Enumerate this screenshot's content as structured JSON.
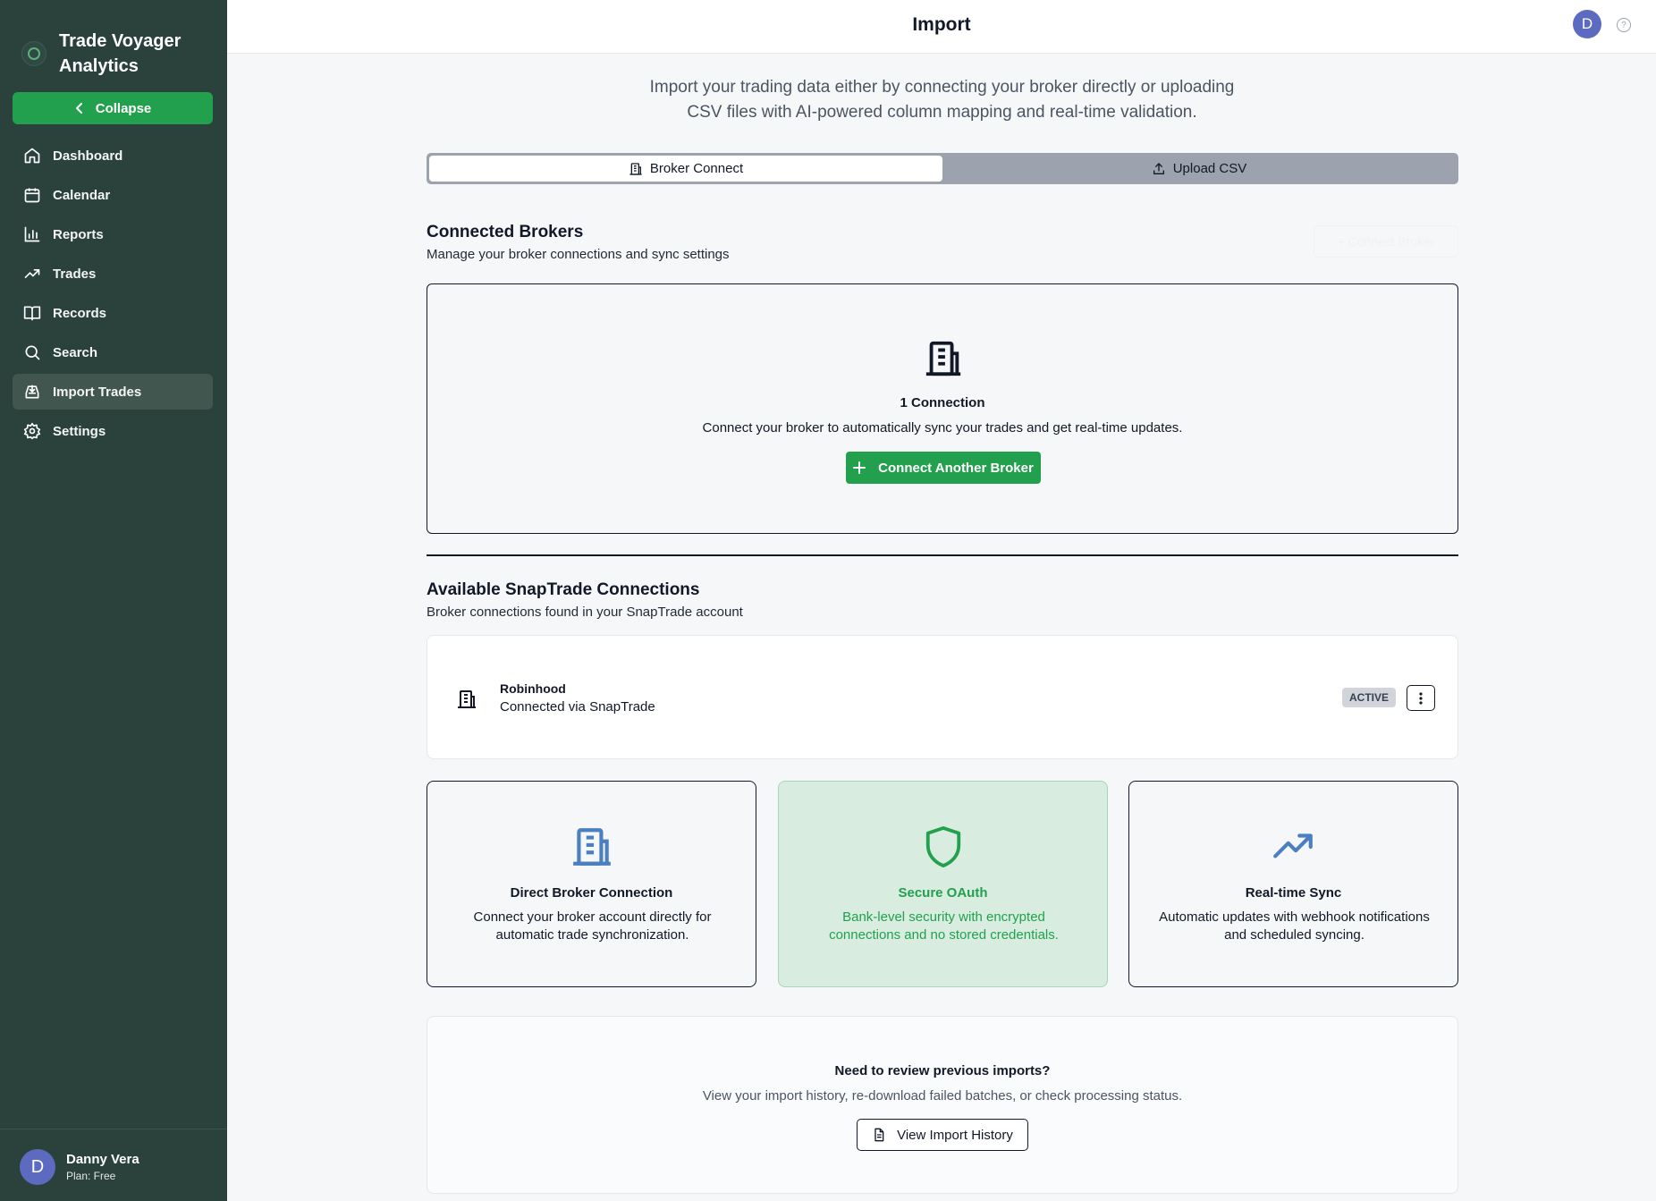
{
  "brand": {
    "name": "Trade Voyager Analytics"
  },
  "sidebar": {
    "collapse_label": "Collapse",
    "items": [
      {
        "label": "Dashboard",
        "icon": "home-icon"
      },
      {
        "label": "Calendar",
        "icon": "calendar-icon"
      },
      {
        "label": "Reports",
        "icon": "bar-chart-icon"
      },
      {
        "label": "Trades",
        "icon": "trending-up-icon"
      },
      {
        "label": "Records",
        "icon": "book-icon"
      },
      {
        "label": "Search",
        "icon": "search-icon"
      },
      {
        "label": "Import Trades",
        "icon": "import-icon",
        "active": true
      },
      {
        "label": "Settings",
        "icon": "gear-icon"
      }
    ],
    "user": {
      "initial": "D",
      "name": "Danny Vera",
      "plan": "Plan: Free"
    }
  },
  "header": {
    "title": "Import",
    "avatar_initial": "D",
    "help": "?"
  },
  "intro": {
    "line1": "Import your trading data either by connecting your broker directly or uploading",
    "line2": "CSV files with AI-powered column mapping and real-time validation."
  },
  "tabs": [
    {
      "label": "Broker Connect",
      "active": true
    },
    {
      "label": "Upload CSV",
      "active": false
    }
  ],
  "connected": {
    "title": "Connected Brokers",
    "subtitle": "Manage your broker connections and sync settings",
    "ghost_button": "+ Connect Broker",
    "count": "1 Connection",
    "description": "Connect your broker to automatically sync your trades and get real-time updates.",
    "button": "Connect Another Broker"
  },
  "available": {
    "title": "Available SnapTrade Connections",
    "subtitle": "Broker connections found in your SnapTrade account",
    "broker": {
      "name": "Robinhood",
      "via": "Connected via SnapTrade",
      "status": "ACTIVE"
    }
  },
  "features": [
    {
      "title": "Direct Broker Connection",
      "desc": "Connect your broker account directly for automatic trade synchronization."
    },
    {
      "title": "Secure OAuth",
      "desc": "Bank-level security with encrypted connections and no stored credentials."
    },
    {
      "title": "Real-time Sync",
      "desc": "Automatic updates with webhook notifications and scheduled syncing."
    }
  ],
  "history": {
    "title": "Need to review previous imports?",
    "desc": "View your import history, re-download failed batches, or check processing status.",
    "button": "View Import History"
  },
  "colors": {
    "sidebar": "#2a423b",
    "accent": "#22a04d",
    "avatar": "#5c6bc0",
    "icon_blue": "#4a7fc1"
  }
}
